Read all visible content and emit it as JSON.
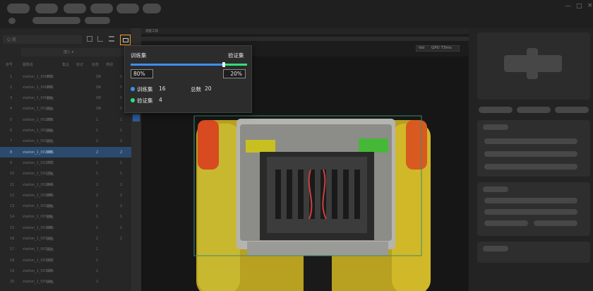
{
  "app": {
    "window_controls": [
      "—",
      "□",
      "×"
    ]
  },
  "left_panel": {
    "search_placeholder": "Q 搜",
    "dropdown_label": "插入 ▾",
    "columns": [
      "序号",
      "图像名",
      "集合",
      "标记",
      "标签",
      "类别"
    ],
    "rows": [
      {
        "no": "1",
        "name": "station_1_00082",
        "set": "训练",
        "a": "OK",
        "b": "0"
      },
      {
        "no": "2",
        "name": "station_1_00083",
        "set": "训练",
        "a": "OK",
        "b": "0"
      },
      {
        "no": "3",
        "name": "station_1_00084",
        "set": "训练",
        "a": "OK",
        "b": "0"
      },
      {
        "no": "4",
        "name": "station_1_00282",
        "set": "训练",
        "a": "OK",
        "b": "0"
      },
      {
        "no": "5",
        "name": "station_1_00283",
        "set": "训练",
        "a": "1",
        "b": "1"
      },
      {
        "no": "6",
        "name": "station_1_00286",
        "set": "训练",
        "a": "1",
        "b": "1"
      },
      {
        "no": "7",
        "name": "station_1_00287",
        "set": "训练",
        "a": "2",
        "b": "2"
      },
      {
        "no": "8",
        "name": "station_1_00288",
        "set": "训练",
        "a": "2",
        "b": "2"
      },
      {
        "no": "9",
        "name": "station_1_00277",
        "set": "训练",
        "a": "1",
        "b": "1"
      },
      {
        "no": "10",
        "name": "station_1_00279",
        "set": "训练",
        "a": "1",
        "b": "1"
      },
      {
        "no": "11",
        "name": "station_1_00284",
        "set": "训练",
        "a": "2",
        "b": "2"
      },
      {
        "no": "12",
        "name": "station_1_00286",
        "set": "训练",
        "a": "2",
        "b": "2"
      },
      {
        "no": "13",
        "name": "station_1_00289",
        "set": "训练",
        "a": "2",
        "b": "2"
      },
      {
        "no": "14",
        "name": "station_1_00306",
        "set": "训练",
        "a": "1",
        "b": "1"
      },
      {
        "no": "15",
        "name": "station_1_00308",
        "set": "训练",
        "a": "1",
        "b": "1"
      },
      {
        "no": "16",
        "name": "station_1_00310",
        "set": "训练",
        "a": "2",
        "b": "2"
      },
      {
        "no": "17",
        "name": "station_1_00311",
        "set": "训练",
        "a": "1",
        "b": ""
      },
      {
        "no": "18",
        "name": "station_1_00312",
        "set": "训练",
        "a": "1",
        "b": ""
      },
      {
        "no": "19",
        "name": "station_1_00313",
        "set": "训练",
        "a": "2",
        "b": ""
      },
      {
        "no": "20",
        "name": "station_1_00314",
        "set": "训练",
        "a": "2",
        "b": ""
      }
    ],
    "selected_row": 7
  },
  "canvas": {
    "toolbar_label": "选框工具",
    "info_label": "Val",
    "info_value": "GPU 73ms",
    "bbox_color": "#3c8c6e"
  },
  "split_popup": {
    "train_label": "训练集",
    "val_label": "验证集",
    "train_fraction": 0.8,
    "train_percent": "80%",
    "val_percent": "20%",
    "train_legend": "训练集",
    "train_count": "16",
    "total_label": "总数",
    "total_count": "20",
    "val_legend": "验证集",
    "val_count": "4",
    "train_color": "#3d8ff0",
    "val_color": "#2ee077"
  },
  "colors": {
    "highlight_border": "#f0a020",
    "selection_row": "#2b4a6e"
  }
}
